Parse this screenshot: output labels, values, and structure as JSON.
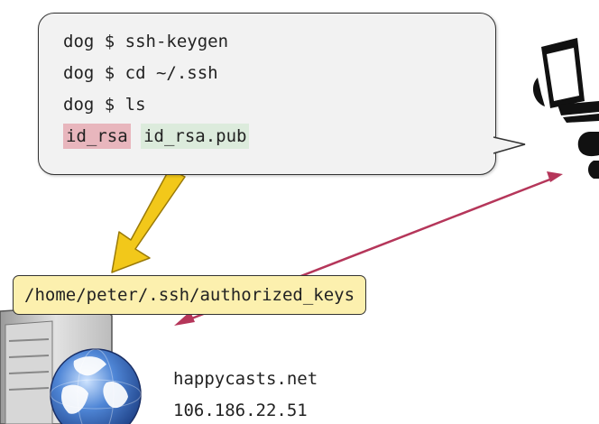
{
  "terminal": {
    "lines": [
      "dog $ ssh-keygen",
      "dog $ cd ~/.ssh",
      "dog $ ls"
    ],
    "files": {
      "private_key": "id_rsa",
      "public_key": "id_rsa.pub"
    }
  },
  "server": {
    "authorized_keys_path": "/home/peter/.ssh/authorized_keys",
    "hostname": "happycasts.net",
    "ip": "106.186.22.51"
  },
  "colors": {
    "private_key_highlight": "#e8b6bd",
    "public_key_highlight": "#dcebdc",
    "copy_arrow": "#f2c81a",
    "connection_arrow": "#b5365a",
    "path_label_bg": "#fcf0ae"
  },
  "icons": [
    "speech-bubble",
    "user-at-computer-icon",
    "server-icon",
    "globe-icon"
  ]
}
